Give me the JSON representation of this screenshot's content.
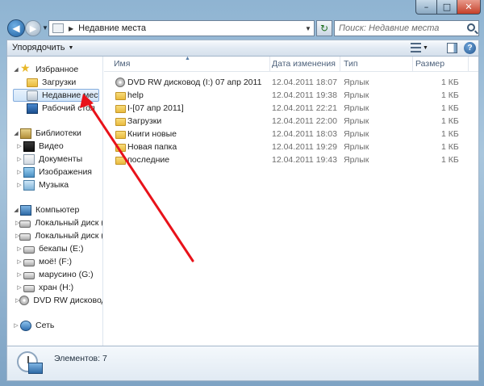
{
  "window": {
    "minimize": "–",
    "maximize": "□",
    "close": "✕"
  },
  "address_bar": {
    "path": "Недавние места",
    "search_placeholder": "Поиск: Недавние места"
  },
  "toolbar": {
    "organize_label": "Упорядочить",
    "help_label": "?"
  },
  "nav": {
    "favorites": {
      "label": "Избранное",
      "items": [
        {
          "label": "Загрузки",
          "icon": "folder-icon"
        },
        {
          "label": "Недавние места",
          "icon": "recent-places-icon",
          "selected": true
        },
        {
          "label": "Рабочий стол",
          "icon": "desktop-icon"
        }
      ]
    },
    "libraries": {
      "label": "Библиотеки",
      "items": [
        {
          "label": "Видео",
          "icon": "video-icon"
        },
        {
          "label": "Документы",
          "icon": "documents-icon"
        },
        {
          "label": "Изображения",
          "icon": "pictures-icon"
        },
        {
          "label": "Музыка",
          "icon": "music-icon"
        }
      ]
    },
    "computer": {
      "label": "Компьютер",
      "items": [
        {
          "label": "Локальный диск (C",
          "icon": "disk-icon"
        },
        {
          "label": "Локальный диск (D",
          "icon": "disk-icon"
        },
        {
          "label": "бекапы (E:)",
          "icon": "disk-icon"
        },
        {
          "label": "моё! (F:)",
          "icon": "disk-icon"
        },
        {
          "label": "марусино (G:)",
          "icon": "disk-icon"
        },
        {
          "label": "хран (H:)",
          "icon": "disk-icon"
        },
        {
          "label": "DVD RW дисковод (",
          "icon": "dvd-icon"
        }
      ]
    },
    "network": {
      "label": "Сеть"
    }
  },
  "columns": {
    "name": "Имя",
    "date": "Дата изменения",
    "type": "Тип",
    "size": "Размер"
  },
  "files": [
    {
      "name": "DVD RW дисковод (I:) 07 апр 2011",
      "date": "12.04.2011 18:07",
      "type": "Ярлык",
      "size": "1 КБ",
      "icon": "dvd-icon"
    },
    {
      "name": "help",
      "date": "12.04.2011 19:38",
      "type": "Ярлык",
      "size": "1 КБ",
      "icon": "folder-icon"
    },
    {
      "name": "I-[07 апр 2011]",
      "date": "12.04.2011 22:21",
      "type": "Ярлык",
      "size": "1 КБ",
      "icon": "folder-icon"
    },
    {
      "name": "Загрузки",
      "date": "12.04.2011 22:00",
      "type": "Ярлык",
      "size": "1 КБ",
      "icon": "folder-icon"
    },
    {
      "name": "Книги новые",
      "date": "12.04.2011 18:03",
      "type": "Ярлык",
      "size": "1 КБ",
      "icon": "folder-icon"
    },
    {
      "name": "Новая папка",
      "date": "12.04.2011 19:29",
      "type": "Ярлык",
      "size": "1 КБ",
      "icon": "folder-icon"
    },
    {
      "name": "последние",
      "date": "12.04.2011 19:43",
      "type": "Ярлык",
      "size": "1 КБ",
      "icon": "folder-icon"
    }
  ],
  "details": {
    "items_count": "Элементов: 7"
  },
  "colors": {
    "annotation_arrow": "#e8121a",
    "selection": "#cfe4f8"
  }
}
